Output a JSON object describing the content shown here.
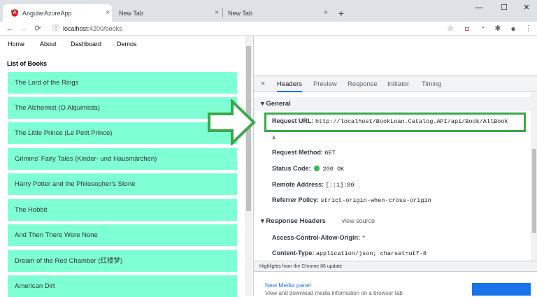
{
  "browser": {
    "tabs": [
      {
        "title": "AngularAzureApp",
        "close": "×"
      },
      {
        "title": "New Tab",
        "close": "×"
      },
      {
        "title": "New Tab",
        "close": "×"
      }
    ],
    "new_tab": "+",
    "window": {
      "minimize": "—",
      "maximize": "☐",
      "close": "✕"
    },
    "url": {
      "host": "localhost",
      "rest": ":4200/books"
    }
  },
  "app": {
    "nav": [
      "Home",
      "About",
      "Dashboard",
      "Demos"
    ],
    "list_title": "List of Books",
    "books": [
      "The Lord of the Rings",
      "The Alchemist (O Alquimista)",
      "The Little Prince (Le Petit Prince)",
      "Grimms' Fairy Tales (Kinder- und Hausmärchen)",
      "Harry Potter and the Philosopher's Stone",
      "The Hobbit",
      "And Then There Were None",
      "Dream of the Red Chamber (红楼梦)",
      "American Dirt"
    ]
  },
  "devtools": {
    "close": "×",
    "tabs": [
      "Headers",
      "Preview",
      "Response",
      "Initiator",
      "Timing"
    ],
    "active_tab": "Headers",
    "general": {
      "title": "General",
      "request_url_label": "Request URL:",
      "request_url_value": "http://localhost/BookLoan.Catalog.API/api/Book/AllBook",
      "request_url_wrap": "s",
      "method_label": "Request Method:",
      "method_value": "GET",
      "status_label": "Status Code:",
      "status_value": "200 OK",
      "remote_label": "Remote Address:",
      "remote_value": "[::1]:80",
      "referrer_label": "Referrer Policy:",
      "referrer_value": "strict-origin-when-cross-origin"
    },
    "response_headers": {
      "title": "Response Headers",
      "view_source": "view source",
      "acao_label": "Access-Control-Allow-Origin:",
      "acao_value": "*",
      "ctype_label": "Content-Type:",
      "ctype_value": "application/json; charset=utf-8"
    },
    "drawer": {
      "bar": "Highlights from the Chrome 86 update",
      "link": "New Media panel",
      "desc": "View and download media information on a browser tab"
    }
  },
  "colors": {
    "book_bg": "#7fffd4",
    "highlight": "#3aa84a",
    "accent": "#1a73e8"
  }
}
